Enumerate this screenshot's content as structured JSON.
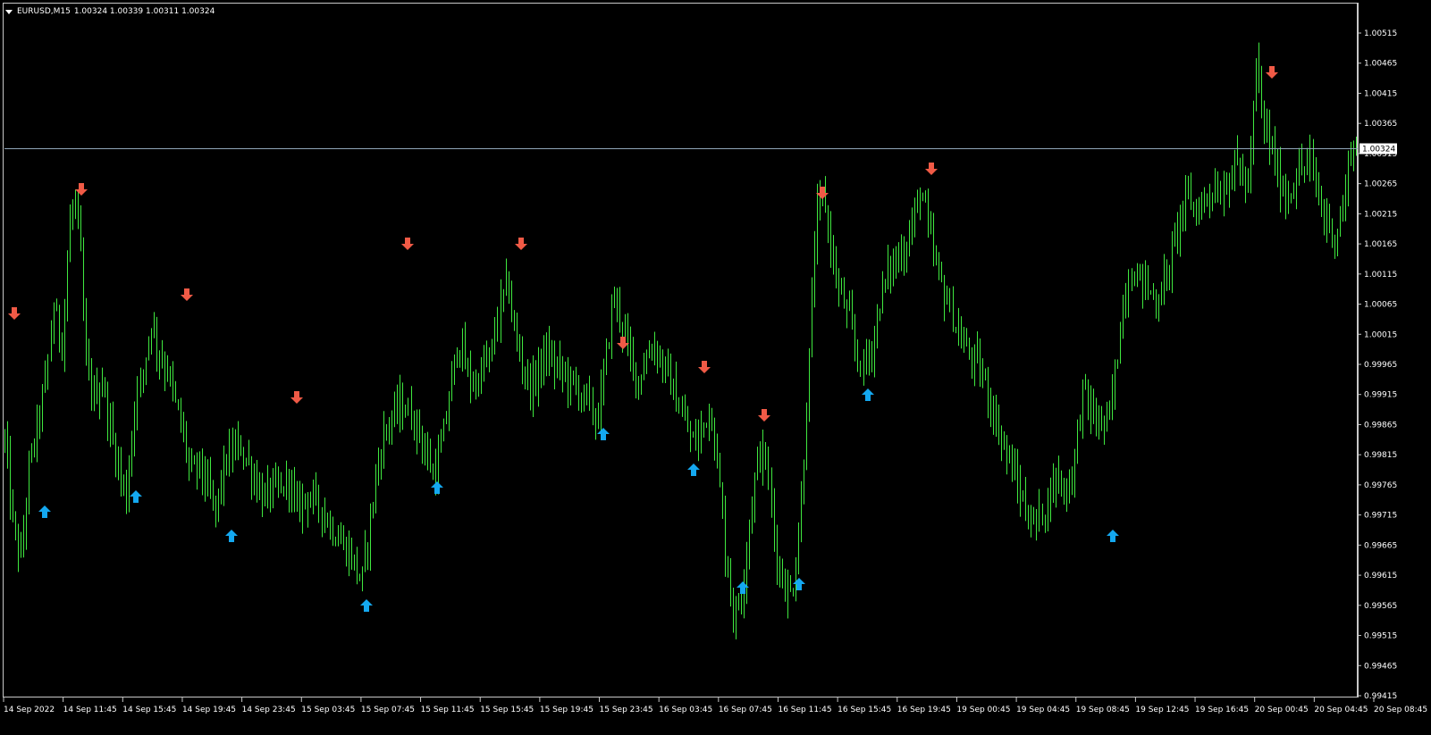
{
  "header": {
    "symbol": "EURUSD,M15",
    "quote": "1.00324 1.00339 1.00311 1.00324"
  },
  "colors": {
    "background": "#000000",
    "candle": "#3fe83f",
    "up_arrow": "#14a8f0",
    "down_arrow": "#f05a46",
    "current_price_line": "#8fa6b8",
    "axis_text": "#ffffff"
  },
  "chart_data": {
    "type": "candlestick",
    "timeframe": "M15",
    "symbol": "EURUSD",
    "current_price": "1.00324",
    "ylim": [
      0.99415,
      1.0054
    ],
    "y_ticks": [
      "1.00515",
      "1.00465",
      "1.00415",
      "1.00365",
      "1.00315",
      "1.00265",
      "1.00215",
      "1.00165",
      "1.00115",
      "1.00065",
      "1.00015",
      "0.99965",
      "0.99915",
      "0.99865",
      "0.99815",
      "0.99765",
      "0.99715",
      "0.99665",
      "0.99615",
      "0.99565",
      "0.99515",
      "0.99465",
      "0.99415"
    ],
    "x_ticks": [
      "14 Sep 2022",
      "14 Sep 11:45",
      "14 Sep 15:45",
      "14 Sep 19:45",
      "14 Sep 23:45",
      "15 Sep 03:45",
      "15 Sep 07:45",
      "15 Sep 11:45",
      "15 Sep 15:45",
      "15 Sep 19:45",
      "15 Sep 23:45",
      "16 Sep 03:45",
      "16 Sep 07:45",
      "16 Sep 11:45",
      "16 Sep 15:45",
      "16 Sep 19:45",
      "19 Sep 00:45",
      "19 Sep 04:45",
      "19 Sep 08:45",
      "19 Sep 12:45",
      "19 Sep 16:45",
      "20 Sep 00:45",
      "20 Sep 04:45",
      "20 Sep 08:45"
    ],
    "price_path": [
      [
        0,
        0.9984
      ],
      [
        0.006,
        0.997
      ],
      [
        0.012,
        0.9964
      ],
      [
        0.018,
        0.9979
      ],
      [
        0.024,
        0.9986
      ],
      [
        0.03,
        0.9993
      ],
      [
        0.036,
        1.0006
      ],
      [
        0.042,
        1.0
      ],
      [
        0.048,
        1.002
      ],
      [
        0.052,
        1.0024
      ],
      [
        0.056,
        1.0014
      ],
      [
        0.06,
        0.9996
      ],
      [
        0.066,
        0.9991
      ],
      [
        0.072,
        0.9994
      ],
      [
        0.078,
        0.9986
      ],
      [
        0.084,
        0.998
      ],
      [
        0.09,
        0.9974
      ],
      [
        0.096,
        0.999
      ],
      [
        0.102,
        0.9995
      ],
      [
        0.108,
        1.0004
      ],
      [
        0.114,
        0.9998
      ],
      [
        0.12,
        0.9996
      ],
      [
        0.126,
        0.999
      ],
      [
        0.132,
        0.9985
      ],
      [
        0.138,
        0.9978
      ],
      [
        0.144,
        0.998
      ],
      [
        0.15,
        0.9976
      ],
      [
        0.156,
        0.9972
      ],
      [
        0.162,
        0.9979
      ],
      [
        0.168,
        0.9982
      ],
      [
        0.174,
        0.9983
      ],
      [
        0.18,
        0.998
      ],
      [
        0.186,
        0.9977
      ],
      [
        0.192,
        0.9974
      ],
      [
        0.198,
        0.9976
      ],
      [
        0.204,
        0.9975
      ],
      [
        0.21,
        0.9978
      ],
      [
        0.216,
        0.9972
      ],
      [
        0.222,
        0.9975
      ],
      [
        0.228,
        0.9974
      ],
      [
        0.234,
        0.9973
      ],
      [
        0.24,
        0.997
      ],
      [
        0.246,
        0.9968
      ],
      [
        0.252,
        0.9966
      ],
      [
        0.258,
        0.9964
      ],
      [
        0.264,
        0.996
      ],
      [
        0.27,
        0.997
      ],
      [
        0.276,
        0.998
      ],
      [
        0.282,
        0.9986
      ],
      [
        0.288,
        0.9988
      ],
      [
        0.294,
        0.999
      ],
      [
        0.3,
        0.9988
      ],
      [
        0.306,
        0.9986
      ],
      [
        0.312,
        0.9981
      ],
      [
        0.318,
        0.9978
      ],
      [
        0.324,
        0.9984
      ],
      [
        0.33,
        0.9993
      ],
      [
        0.336,
        1.0001
      ],
      [
        0.342,
        0.9995
      ],
      [
        0.348,
        0.9993
      ],
      [
        0.354,
        0.9996
      ],
      [
        0.36,
        0.9998
      ],
      [
        0.366,
        1.0006
      ],
      [
        0.372,
        1.001
      ],
      [
        0.378,
        1.0
      ],
      [
        0.384,
        0.9996
      ],
      [
        0.39,
        0.9992
      ],
      [
        0.396,
        0.9997
      ],
      [
        0.402,
        0.9998
      ],
      [
        0.408,
        0.9996
      ],
      [
        0.414,
        0.9995
      ],
      [
        0.42,
        0.9993
      ],
      [
        0.426,
        0.9992
      ],
      [
        0.432,
        0.999
      ],
      [
        0.438,
        0.9987
      ],
      [
        0.444,
        0.9996
      ],
      [
        0.45,
        1.0008
      ],
      [
        0.456,
        1.0004
      ],
      [
        0.462,
        0.9998
      ],
      [
        0.468,
        0.9994
      ],
      [
        0.474,
        0.9997
      ],
      [
        0.48,
        1.0
      ],
      [
        0.486,
        0.9997
      ],
      [
        0.492,
        0.9994
      ],
      [
        0.498,
        0.999
      ],
      [
        0.504,
        0.9986
      ],
      [
        0.51,
        0.9983
      ],
      [
        0.516,
        0.9986
      ],
      [
        0.522,
        0.999
      ],
      [
        0.528,
        0.9978
      ],
      [
        0.534,
        0.9964
      ],
      [
        0.54,
        0.9954
      ],
      [
        0.546,
        0.996
      ],
      [
        0.552,
        0.9972
      ],
      [
        0.558,
        0.9982
      ],
      [
        0.564,
        0.998
      ],
      [
        0.57,
        0.9966
      ],
      [
        0.576,
        0.996
      ],
      [
        0.582,
        0.9958
      ],
      [
        0.588,
        0.997
      ],
      [
        0.594,
        0.9992
      ],
      [
        0.6,
        1.002
      ],
      [
        0.606,
        1.0025
      ],
      [
        0.612,
        1.0015
      ],
      [
        0.618,
        1.0008
      ],
      [
        0.624,
        1.0005
      ],
      [
        0.63,
        0.9998
      ],
      [
        0.636,
        0.9996
      ],
      [
        0.642,
        1.0
      ],
      [
        0.648,
        1.0008
      ],
      [
        0.654,
        1.0012
      ],
      [
        0.66,
        1.0014
      ],
      [
        0.666,
        1.0016
      ],
      [
        0.672,
        1.002
      ],
      [
        0.678,
        1.0026
      ],
      [
        0.684,
        1.0018
      ],
      [
        0.69,
        1.0012
      ],
      [
        0.696,
        1.0008
      ],
      [
        0.702,
        1.0004
      ],
      [
        0.708,
        1.0
      ],
      [
        0.714,
        0.9998
      ],
      [
        0.72,
        0.9996
      ],
      [
        0.726,
        0.9993
      ],
      [
        0.732,
        0.9988
      ],
      [
        0.738,
        0.9984
      ],
      [
        0.744,
        0.998
      ],
      [
        0.75,
        0.9976
      ],
      [
        0.756,
        0.9972
      ],
      [
        0.762,
        0.997
      ],
      [
        0.768,
        0.9972
      ],
      [
        0.774,
        0.9976
      ],
      [
        0.78,
        0.9978
      ],
      [
        0.786,
        0.9975
      ],
      [
        0.792,
        0.9982
      ],
      [
        0.798,
        0.9993
      ],
      [
        0.804,
        0.9988
      ],
      [
        0.81,
        0.9987
      ],
      [
        0.816,
        0.9986
      ],
      [
        0.822,
        0.9995
      ],
      [
        0.828,
        1.0008
      ],
      [
        0.834,
        1.0012
      ],
      [
        0.84,
        1.0011
      ],
      [
        0.846,
        1.0009
      ],
      [
        0.852,
        1.0007
      ],
      [
        0.858,
        1.001
      ],
      [
        0.864,
        1.0015
      ],
      [
        0.87,
        1.0022
      ],
      [
        0.876,
        1.0024
      ],
      [
        0.882,
        1.0022
      ],
      [
        0.888,
        1.0024
      ],
      [
        0.894,
        1.0026
      ],
      [
        0.9,
        1.0025
      ],
      [
        0.906,
        1.0028
      ],
      [
        0.912,
        1.003
      ],
      [
        0.918,
        1.0026
      ],
      [
        0.922,
        1.003
      ],
      [
        0.926,
        1.0047
      ],
      [
        0.93,
        1.0038
      ],
      [
        0.936,
        1.0033
      ],
      [
        0.942,
        1.0028
      ],
      [
        0.948,
        1.0024
      ],
      [
        0.954,
        1.0027
      ],
      [
        0.96,
        1.0029
      ],
      [
        0.966,
        1.003
      ],
      [
        0.972,
        1.0024
      ],
      [
        0.978,
        1.002
      ],
      [
        0.984,
        1.0018
      ],
      [
        0.99,
        1.0022
      ],
      [
        0.996,
        1.0033
      ],
      [
        1.0,
        1.00324
      ]
    ],
    "up_signals": [
      0.03,
      0.097,
      0.168,
      0.268,
      0.32,
      0.443,
      0.51,
      0.546,
      0.588,
      0.639,
      0.82
    ],
    "down_signals": [
      0.007,
      0.057,
      0.135,
      0.216,
      0.298,
      0.382,
      0.458,
      0.518,
      0.562,
      0.605,
      0.686,
      0.938
    ],
    "up_signal_prices": [
      0.9972,
      0.99745,
      0.9968,
      0.99565,
      0.9976,
      0.9985,
      0.9979,
      0.99595,
      0.996,
      0.99915,
      0.9968
    ],
    "down_signal_prices": [
      1.0005,
      1.00255,
      1.0008,
      0.9991,
      1.00165,
      1.00165,
      1.0,
      0.9996,
      0.9988,
      1.0025,
      1.0029,
      1.0045
    ]
  }
}
